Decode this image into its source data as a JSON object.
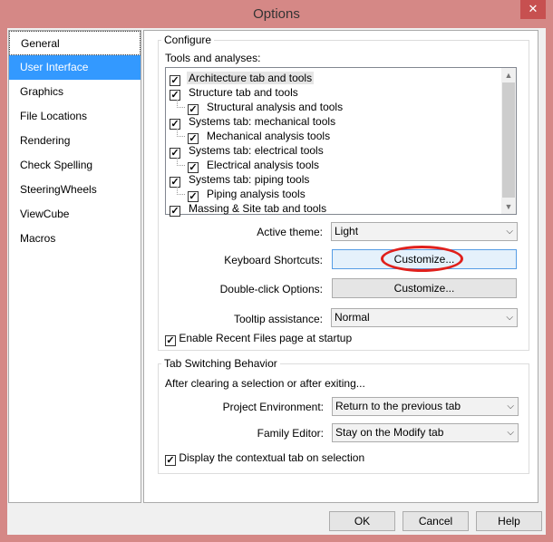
{
  "window": {
    "title": "Options",
    "close_icon": "close-icon"
  },
  "nav": {
    "items": [
      {
        "label": "General"
      },
      {
        "label": "User Interface",
        "selected": true
      },
      {
        "label": "Graphics"
      },
      {
        "label": "File Locations"
      },
      {
        "label": "Rendering"
      },
      {
        "label": "Check Spelling"
      },
      {
        "label": "SteeringWheels"
      },
      {
        "label": "ViewCube"
      },
      {
        "label": "Macros"
      }
    ]
  },
  "configure": {
    "legend": "Configure",
    "tools_label": "Tools and analyses:",
    "tools": [
      {
        "label": "Architecture tab and tools",
        "checked": true,
        "child": false
      },
      {
        "label": "Structure tab and tools",
        "checked": true,
        "child": false
      },
      {
        "label": "Structural analysis and tools",
        "checked": true,
        "child": true
      },
      {
        "label": "Systems tab: mechanical tools",
        "checked": true,
        "child": false
      },
      {
        "label": "Mechanical analysis tools",
        "checked": true,
        "child": true
      },
      {
        "label": "Systems tab: electrical tools",
        "checked": true,
        "child": false
      },
      {
        "label": "Electrical analysis tools",
        "checked": true,
        "child": true
      },
      {
        "label": "Systems tab: piping tools",
        "checked": true,
        "child": false
      },
      {
        "label": "Piping analysis tools",
        "checked": true,
        "child": true
      },
      {
        "label": "Massing & Site tab and tools",
        "checked": true,
        "child": false
      }
    ],
    "active_theme_label": "Active theme:",
    "active_theme": "Light",
    "keyboard_label": "Keyboard Shortcuts:",
    "keyboard_button": "Customize...",
    "doubleclick_label": "Double-click Options:",
    "doubleclick_button": "Customize...",
    "tooltip_label": "Tooltip assistance:",
    "tooltip": "Normal",
    "recent_files": "Enable Recent Files page at startup"
  },
  "tabswitch": {
    "legend": "Tab Switching Behavior",
    "intro": "After clearing a selection or after exiting...",
    "project_label": "Project Environment:",
    "project": "Return to the previous tab",
    "family_label": "Family Editor:",
    "family": "Stay on the Modify tab",
    "contextual": "Display the contextual tab on selection"
  },
  "buttons": {
    "ok": "OK",
    "cancel": "Cancel",
    "help": "Help"
  },
  "colors": {
    "title_bar": "#d58886",
    "selection": "#3399ff",
    "annotation": "#e0201c"
  }
}
